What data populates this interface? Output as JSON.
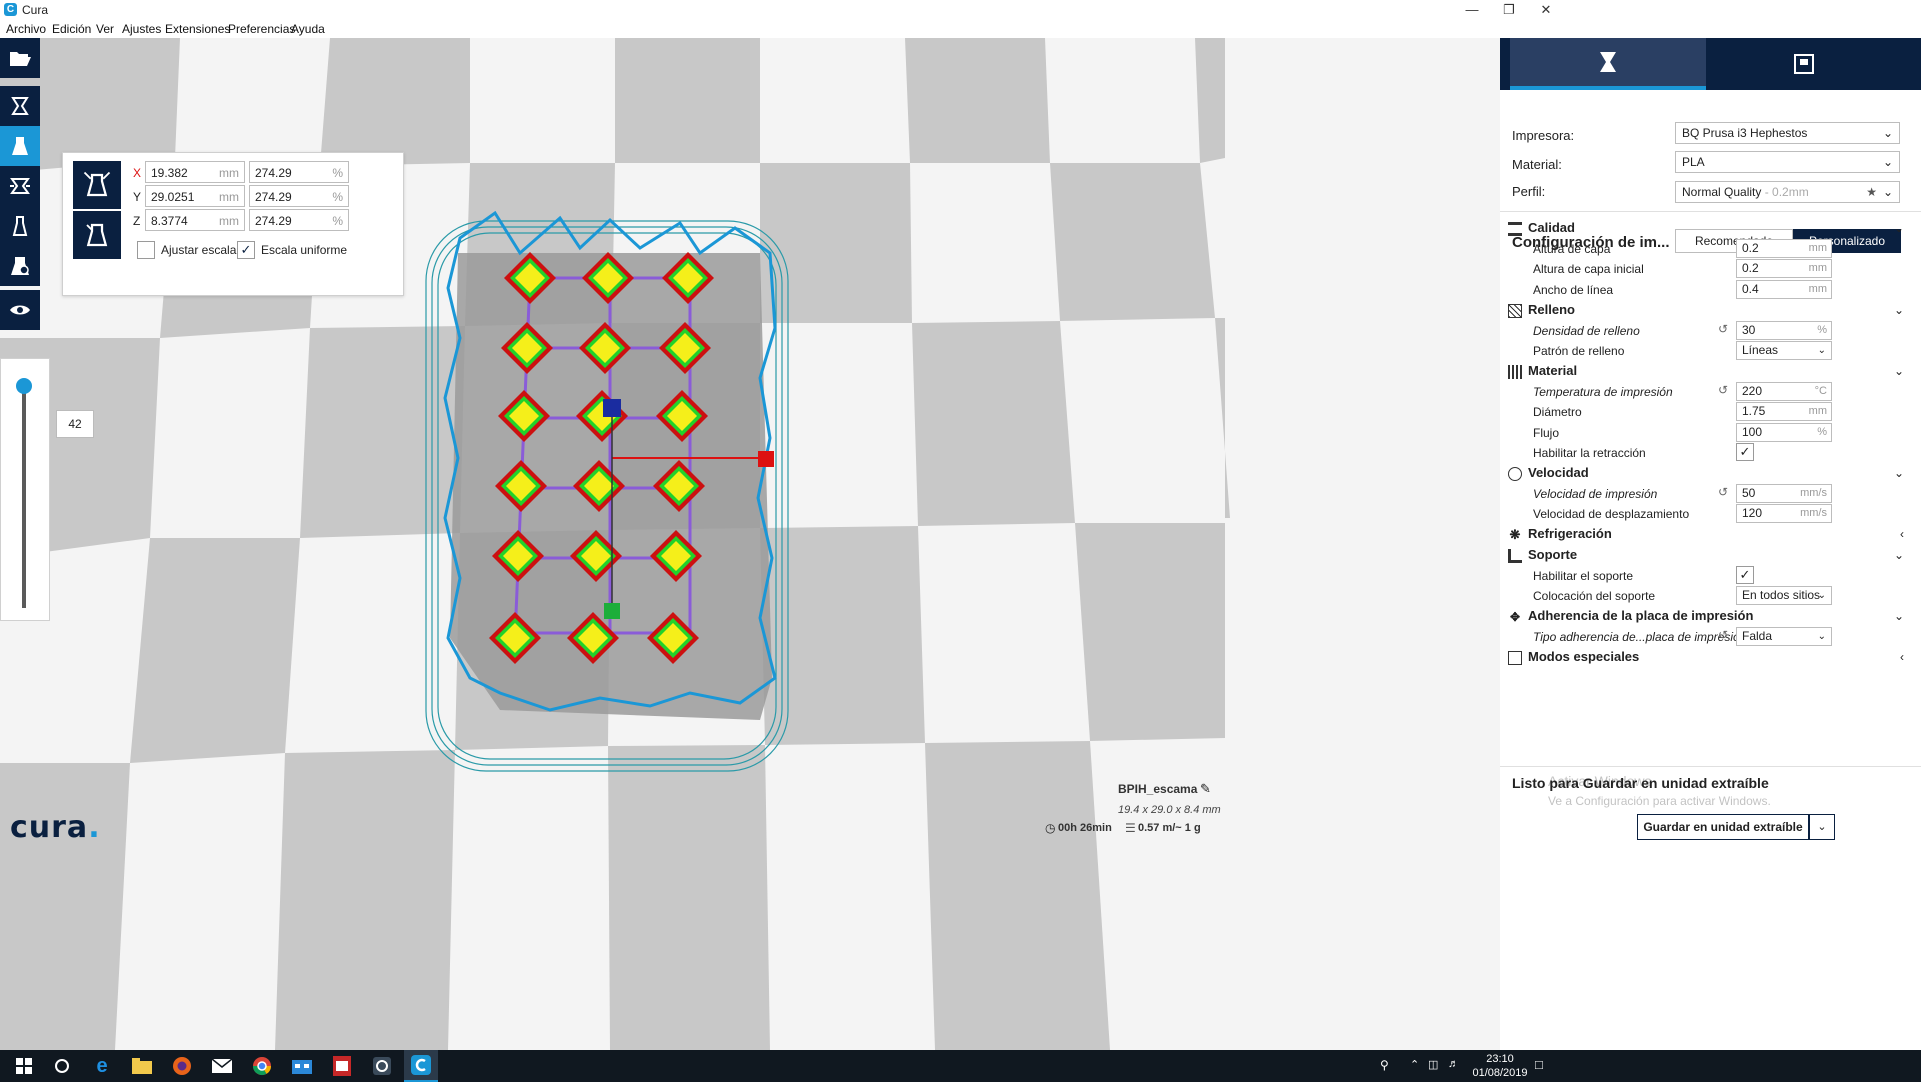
{
  "window": {
    "title": "Cura"
  },
  "menu": [
    "Archivo",
    "Edición",
    "Ver",
    "Ajustes",
    "Extensiones",
    "Preferencias",
    "Ayuda"
  ],
  "scale_panel": {
    "x_label": "X",
    "y_label": "Y",
    "z_label": "Z",
    "x_mm": "19.382",
    "y_mm": "29.0251",
    "z_mm": "8.3774",
    "x_pct": "274.29",
    "y_pct": "274.29",
    "z_pct": "274.29",
    "mm_unit": "mm",
    "pct_unit": "%",
    "snap_label": "Ajustar escala",
    "uniform_label": "Escala uniforme",
    "uniform_checked": true,
    "snap_checked": false
  },
  "layer_view": {
    "layer": "42"
  },
  "right_panel": {
    "printer_label": "Impresora:",
    "printer_value": "BQ Prusa i3 Hephestos",
    "material_label": "Material:",
    "material_value": "PLA",
    "profile_label": "Perfil:",
    "profile_value": "Normal Quality",
    "profile_layer": " - 0.2mm",
    "config_title": "Configuración de im...",
    "mode_recommended": "Recomendado",
    "mode_custom": "Personalizado",
    "sections": {
      "calidad": "Calidad",
      "relleno": "Relleno",
      "material": "Material",
      "velocidad": "Velocidad",
      "refrigeracion": "Refrigeración",
      "soporte": "Soporte",
      "adherencia": "Adherencia de la placa de impresión",
      "especiales": "Modos especiales"
    },
    "settings": {
      "altura_capa": {
        "label": "Altura de capa",
        "value": "0.2",
        "unit": "mm"
      },
      "altura_capa_inicial": {
        "label": "Altura de capa inicial",
        "value": "0.2",
        "unit": "mm"
      },
      "ancho_linea": {
        "label": "Ancho de línea",
        "value": "0.4",
        "unit": "mm"
      },
      "densidad_relleno": {
        "label": "Densidad de relleno",
        "value": "30",
        "unit": "%"
      },
      "patron_relleno": {
        "label": "Patrón de relleno",
        "value": "Líneas"
      },
      "temperatura": {
        "label": "Temperatura de impresión",
        "value": "220",
        "unit": "°C"
      },
      "diametro": {
        "label": "Diámetro",
        "value": "1.75",
        "unit": "mm"
      },
      "flujo": {
        "label": "Flujo",
        "value": "100",
        "unit": "%"
      },
      "retraccion": {
        "label": "Habilitar la retracción"
      },
      "vel_impresion": {
        "label": "Velocidad de impresión",
        "value": "50",
        "unit": "mm/s"
      },
      "vel_desplazamiento": {
        "label": "Velocidad de desplazamiento",
        "value": "120",
        "unit": "mm/s"
      },
      "habilitar_soporte": {
        "label": "Habilitar el soporte"
      },
      "colocacion_soporte": {
        "label": "Colocación del soporte",
        "value": "En todos sitios"
      },
      "tipo_adherencia": {
        "label": "Tipo adherencia de...placa de impresión",
        "value": "Falda"
      }
    },
    "save_status": "Listo para Guardar en unidad extraíble",
    "save_button": "Guardar en unidad extraíble",
    "watermark_title": "Activar Windows",
    "watermark_sub": "Ve a Configuración para activar Windows."
  },
  "job": {
    "name": "BPIH_escama",
    "dims": "19.4 x 29.0 x 8.4 mm",
    "time": "00h 26min",
    "material": "0.57 m/~ 1 g"
  },
  "logo": {
    "text": "cura",
    "dot": "."
  },
  "taskbar": {
    "time": "23:10",
    "date": "01/08/2019"
  },
  "colors": {
    "accent": "#1b97d6",
    "dark": "#0a2040"
  }
}
